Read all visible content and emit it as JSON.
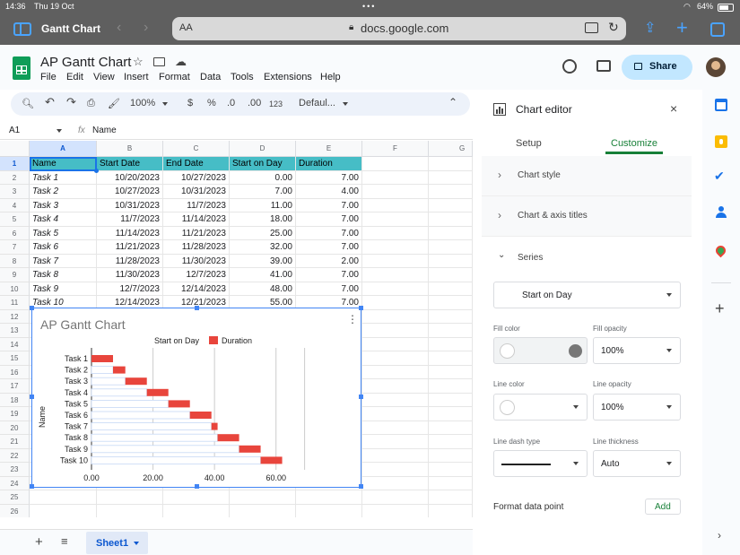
{
  "status": {
    "time": "14:36",
    "date": "Thu 19 Oct",
    "battery": "64%"
  },
  "browser": {
    "tab_title": "Gantt Chart",
    "aa": "AA",
    "url": "docs.google.com"
  },
  "doc": {
    "title": "AP Gantt Chart",
    "menu": [
      "File",
      "Edit",
      "View",
      "Insert",
      "Format",
      "Data",
      "Tools",
      "Extensions",
      "Help"
    ],
    "share_label": "Share"
  },
  "toolbar": {
    "zoom": "100%",
    "currency": "$",
    "percent": "%",
    "dec_decrease": ".0",
    "dec_increase": ".00",
    "format_123": "123",
    "font": "Defaul..."
  },
  "formula": {
    "cell_ref": "A1",
    "fx": "fx",
    "value": "Name"
  },
  "grid": {
    "columns": [
      "A",
      "B",
      "C",
      "D",
      "E",
      "F",
      "G"
    ],
    "row_numbers": [
      "1",
      "2",
      "3",
      "4",
      "5",
      "6",
      "7",
      "8",
      "9",
      "10",
      "11",
      "12",
      "13",
      "14",
      "15",
      "16",
      "17",
      "18",
      "19",
      "20",
      "21",
      "22",
      "23",
      "24",
      "25",
      "26"
    ],
    "header": [
      "Name",
      "Start Date",
      "End Date",
      "Start on Day",
      "Duration"
    ],
    "rows": [
      [
        "Task 1",
        "10/20/2023",
        "10/27/2023",
        "0.00",
        "7.00"
      ],
      [
        "Task 2",
        "10/27/2023",
        "10/31/2023",
        "7.00",
        "4.00"
      ],
      [
        "Task 3",
        "10/31/2023",
        "11/7/2023",
        "11.00",
        "7.00"
      ],
      [
        "Task 4",
        "11/7/2023",
        "11/14/2023",
        "18.00",
        "7.00"
      ],
      [
        "Task 5",
        "11/14/2023",
        "11/21/2023",
        "25.00",
        "7.00"
      ],
      [
        "Task 6",
        "11/21/2023",
        "11/28/2023",
        "32.00",
        "7.00"
      ],
      [
        "Task 7",
        "11/28/2023",
        "11/30/2023",
        "39.00",
        "2.00"
      ],
      [
        "Task 8",
        "11/30/2023",
        "12/7/2023",
        "41.00",
        "7.00"
      ],
      [
        "Task 9",
        "12/7/2023",
        "12/14/2023",
        "48.00",
        "7.00"
      ],
      [
        "Task 10",
        "12/14/2023",
        "12/21/2023",
        "55.00",
        "7.00"
      ]
    ]
  },
  "chart_data": {
    "type": "bar",
    "orientation": "horizontal",
    "stacked": true,
    "title": "AP Gantt Chart",
    "ylabel": "Name",
    "categories": [
      "Task 1",
      "Task 2",
      "Task 3",
      "Task 4",
      "Task 5",
      "Task 6",
      "Task 7",
      "Task 8",
      "Task 9",
      "Task 10"
    ],
    "series": [
      {
        "name": "Start on Day",
        "values": [
          0,
          7,
          11,
          18,
          25,
          32,
          39,
          41,
          48,
          55
        ],
        "color": "#ffffff"
      },
      {
        "name": "Duration",
        "values": [
          7,
          4,
          7,
          7,
          7,
          7,
          2,
          7,
          7,
          7
        ],
        "color": "#e8453c"
      }
    ],
    "x_ticks": [
      "0.00",
      "20.00",
      "40.00",
      "60.00"
    ],
    "xlim": [
      0,
      70
    ],
    "legend": "top",
    "grid": true
  },
  "sheet": {
    "tab": "Sheet1"
  },
  "editor": {
    "title": "Chart editor",
    "tabs": [
      "Setup",
      "Customize"
    ],
    "active_tab": "Customize",
    "sections": [
      "Chart style",
      "Chart & axis titles",
      "Series"
    ],
    "series_selected": "Start on Day",
    "fill_color_label": "Fill color",
    "fill_opacity_label": "Fill opacity",
    "fill_opacity": "100%",
    "line_color_label": "Line color",
    "line_opacity_label": "Line opacity",
    "line_opacity": "100%",
    "line_dash_label": "Line dash type",
    "line_thickness_label": "Line thickness",
    "line_thickness": "Auto",
    "format_point_label": "Format data point",
    "add_label": "Add"
  },
  "colors": {
    "accent": "#188038",
    "header_fill": "#46bdc6",
    "bar": "#e8453c",
    "blue": "#4285f4"
  }
}
